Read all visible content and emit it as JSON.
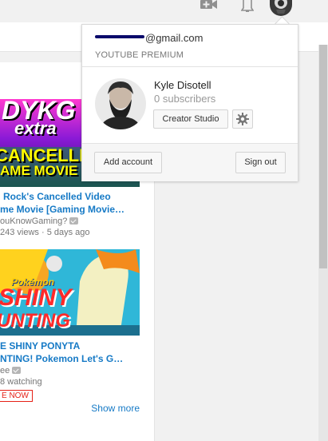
{
  "header": {
    "upload_icon": "video-camera-plus-icon",
    "notifications_icon": "bell-icon",
    "avatar_icon": "account-avatar-icon"
  },
  "feed": {
    "videos": [
      {
        "title_line1": "Rock's Cancelled Video",
        "title_line2": "me Movie [Gaming Movie…",
        "channel": "ouKnowGaming?",
        "stats": "243 views · 5 days ago",
        "thumb_text_top": "DYKG",
        "thumb_text_mid": "extra",
        "thumb_text_line1": "CANCELLE",
        "thumb_text_line2": "AME MOVIE"
      },
      {
        "title_line1": "E SHINY PONYTA",
        "title_line2": "NTING! Pokemon Let's G…",
        "channel": "ee",
        "stats": "8 watching",
        "live_label": "E NOW",
        "thumb_text_brand": "Pokémon",
        "thumb_text_line1": "SHINY",
        "thumb_text_line2": "UNTING"
      }
    ],
    "show_more": "Show more"
  },
  "account_menu": {
    "email_suffix": "@gmail.com",
    "membership": "YOUTUBE PREMIUM",
    "name": "Kyle Disotell",
    "subscribers": "0 subscribers",
    "creator_studio": "Creator Studio",
    "settings_icon": "gear-icon",
    "add_account": "Add account",
    "sign_out": "Sign out"
  },
  "colors": {
    "link_blue": "#167ac6",
    "live_red": "#e62117",
    "background": "#f1f1f1"
  }
}
